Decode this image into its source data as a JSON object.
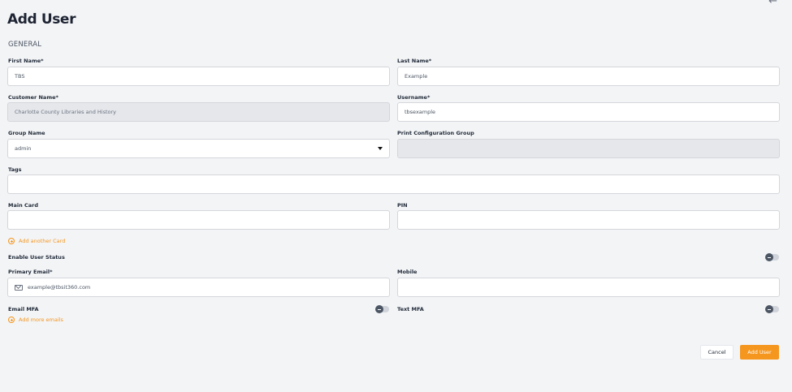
{
  "page": {
    "title": "Add User",
    "back_icon": "arrow-left-icon"
  },
  "section": {
    "general": "GENERAL"
  },
  "fields": {
    "first_name": {
      "label": "First Name*",
      "value": "TBS"
    },
    "last_name": {
      "label": "Last Name*",
      "value": "Example"
    },
    "customer_name": {
      "label": "Customer Name*",
      "value": "Charlotte County Libraries and History"
    },
    "username": {
      "label": "Username*",
      "value": "tbsexample"
    },
    "group_name": {
      "label": "Group Name",
      "value": "admin"
    },
    "print_config_group": {
      "label": "Print Configuration Group",
      "value": ""
    },
    "tags": {
      "label": "Tags",
      "value": ""
    },
    "main_card": {
      "label": "Main Card",
      "value": ""
    },
    "pin": {
      "label": "PIN",
      "value": ""
    },
    "primary_email": {
      "label": "Primary Email*",
      "value": "example@tbsit360.com"
    },
    "mobile": {
      "label": "Mobile",
      "value": ""
    }
  },
  "links": {
    "add_card": "Add another Card",
    "add_emails": "Add more emails"
  },
  "toggles": {
    "enable_user_status": "Enable User Status",
    "email_mfa": "Email MFA",
    "text_mfa": "Text MFA"
  },
  "buttons": {
    "cancel": "Cancel",
    "add_user": "Add User"
  },
  "colors": {
    "accent": "#f5961e",
    "background": "#f3f4f6",
    "disabled_field": "#e5e7eb"
  }
}
